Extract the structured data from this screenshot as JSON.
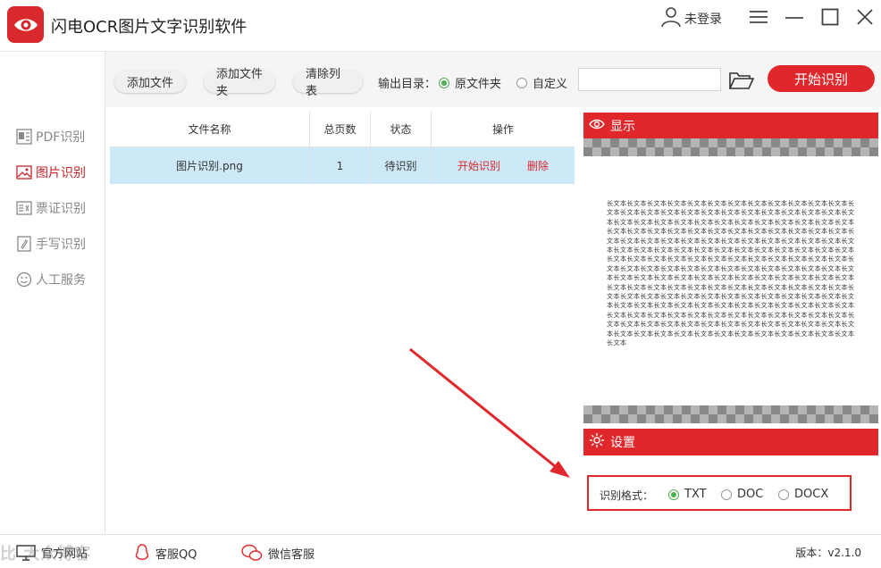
{
  "app": {
    "title": "闪电OCR图片文字识别软件",
    "user_label": "未登录"
  },
  "sidebar": {
    "items": [
      {
        "label": "PDF识别",
        "icon": "pdf-icon"
      },
      {
        "label": "图片识别",
        "icon": "image-icon"
      },
      {
        "label": "票证识别",
        "icon": "ticket-icon"
      },
      {
        "label": "手写识别",
        "icon": "handwriting-icon"
      },
      {
        "label": "人工服务",
        "icon": "smile-icon"
      }
    ],
    "active_index": 1
  },
  "toolbar": {
    "add_file": "添加文件",
    "add_folder": "添加文件夹",
    "clear_list": "清除列表",
    "output_label": "输出目录：",
    "opt_original": "原文件夹",
    "opt_custom": "自定义",
    "path_value": "",
    "start_label": "开始识别"
  },
  "table": {
    "headers": [
      "文件名称",
      "总页数",
      "状态",
      "操作"
    ],
    "rows": [
      {
        "name": "图片识别.png",
        "pages": "1",
        "status": "待识别",
        "op_start": "开始识别",
        "op_delete": "删除"
      }
    ]
  },
  "display": {
    "title": "显示",
    "preview_text": "长文本长文本长文本长文本长文本长文本长文本长文本长文本长文本长文本长文本长文本长文本长文本长文本长文本长文本长文本长文本长文本长文本长文本长文本长文本长文本长文本长文本长文本长文本长文本长文本长文本长文本长文本长文本长文本长文本长文本长文本长文本长文本长文本长文本长文本长文本长文本长文本长文本长文本长文本长文本长文本长文本长文本长文本长文本长文本长文本长文本长文本长文本长文本长文本长文本长文本长文本长文本长文本长文本长文本长文本长文本长文本长文本长文本长文本长文本长文本长文本长文本长文本长文本长文本长文本长文本长文本长文本长文本长文本长文本长文本长文本长文本长文本长文本长文本长文本长文本长文本长文本长文本长文本长文本长文本长文本长文本长文本长文本长文本长文本长文本长文本长文本长文本长文本长文本长文本长文本长文本长文本长文本长文本长文本长文本长文本长文本长文本长文本长文本长文本长文本长文本长文本长文本长文本长文本长文本长文本长文本长文本长文本长文本长文本长文本长文本长文本长文本长文本长文本长文本长文本长文本长文本长文本长文本长文本长文本长文本长文本长文本长文本长文本长文本长文本长文本长文本长文本长文本长文本长文本长文本长文本长文本长文本长文本长文本长文本长文本长文本长文本长文本长文本长文本长文本长文本"
  },
  "settings": {
    "title": "设置",
    "format_label": "识别格式：",
    "formats": [
      "TXT",
      "DOC",
      "DOCX"
    ],
    "selected_format": "TXT"
  },
  "statusbar": {
    "website": "官方网站",
    "qq": "客服QQ",
    "wechat": "微信客服",
    "version": "版本：v2.1.0"
  },
  "watermark": "比 大众博客",
  "colors": {
    "accent": "#e0282c",
    "row_selected": "#cde8f7",
    "radio_on": "#4caf50"
  }
}
